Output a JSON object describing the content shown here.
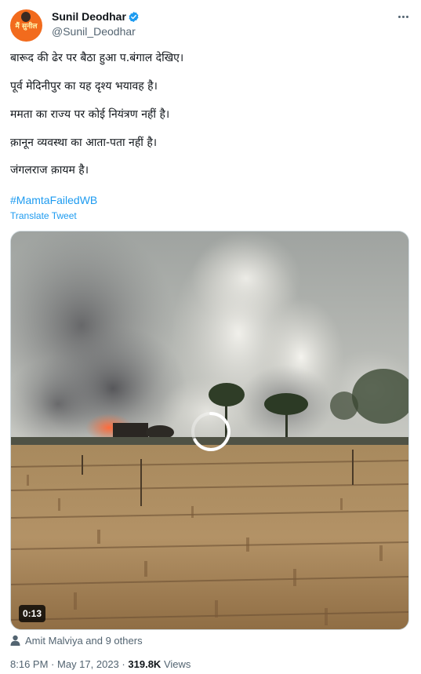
{
  "author": {
    "display_name": "Sunil Deodhar",
    "handle": "@Sunil_Deodhar",
    "avatar_text": "मैं सुनील"
  },
  "tweet": {
    "lines": [
      "बारूद की ढेर पर बैठा हुआ प.बंगाल देखिए।",
      "पूर्व मेदिनीपुर का यह दृश्य भयावह है।",
      "ममता का राज्य पर कोई नियंत्रण नहीं है।",
      "क़ानून व्यवस्था का आता-पता नहीं है।",
      "जंगलराज क़ायम है।"
    ],
    "hashtag": "#MamtaFailedWB",
    "translate_label": "Translate Tweet"
  },
  "media": {
    "duration": "0:13",
    "tagged_users": "Amit Malviya and 9 others"
  },
  "meta": {
    "time": "8:16 PM",
    "separator": "·",
    "date": "May 17, 2023",
    "views_count": "319.8K",
    "views_label": "Views"
  },
  "colors": {
    "link": "#1d9bf0",
    "secondary_text": "#536471",
    "verified_badge": "#1d9bf0",
    "avatar_bg": "#f26b1d"
  },
  "icons": {
    "verified": "verified-badge-icon",
    "more": "more-options-icon",
    "tagged": "person-icon",
    "loading": "loading-spinner-icon"
  }
}
